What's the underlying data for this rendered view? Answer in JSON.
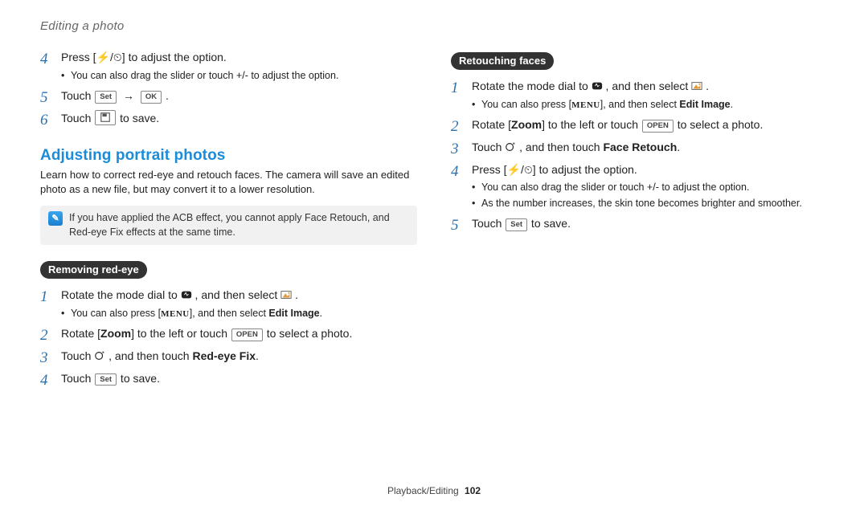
{
  "header": {
    "title": "Editing a photo"
  },
  "left": {
    "steps_a": [
      {
        "text": "Press [⚡/⏲] to adjust the option.",
        "sub": [
          "You can also drag the slider or touch +/- to adjust the option."
        ]
      },
      {
        "pre": "Touch ",
        "btn1": "Set",
        "arrow": "→",
        "btn2": "OK",
        "post": " ."
      },
      {
        "pre": "Touch ",
        "btn1": "💾",
        "post": " to save."
      }
    ],
    "heading": "Adjusting portrait photos",
    "intro": "Learn how to correct red-eye and retouch faces. The camera will save an edited photo as a new file, but may convert it to a lower resolution.",
    "note": "If you have applied the ACB effect, you cannot apply Face Retouch, and Red-eye Fix effects at the same time.",
    "pill": "Removing red-eye",
    "steps_b": [
      {
        "pre": "Rotate the mode dial to ",
        "icon": "magic",
        "mid": ", and then select ",
        "icon2": "picture",
        "post": ".",
        "sub_pre": "You can also press [",
        "sub_menu": "MENU",
        "sub_mid": "], and then select ",
        "sub_bold": "Edit Image",
        "sub_post": "."
      },
      {
        "pre": "Rotate [",
        "bold1": "Zoom",
        "mid": "] to the left or touch ",
        "btn": "OPEN",
        "post": " to select a photo."
      },
      {
        "pre": "Touch ",
        "icon": "retouch",
        "mid": ", and then touch ",
        "bold1": "Red-eye Fix",
        "post": "."
      },
      {
        "pre": "Touch ",
        "btn": "Set",
        "post": " to save."
      }
    ]
  },
  "right": {
    "pill": "Retouching faces",
    "steps": [
      {
        "pre": "Rotate the mode dial to ",
        "icon": "magic",
        "mid": ", and then select ",
        "icon2": "picture",
        "post": ".",
        "sub_pre": "You can also press [",
        "sub_menu": "MENU",
        "sub_mid": "], and then select ",
        "sub_bold": "Edit Image",
        "sub_post": "."
      },
      {
        "pre": "Rotate [",
        "bold1": "Zoom",
        "mid": "] to the left or touch ",
        "btn": "OPEN",
        "post": " to select a photo."
      },
      {
        "pre": "Touch ",
        "icon": "retouch",
        "mid": ", and then touch ",
        "bold1": "Face Retouch",
        "post": "."
      },
      {
        "text": "Press [⚡/⏲] to adjust the option.",
        "sub2": [
          "You can also drag the slider or touch +/- to adjust the option.",
          "As the number increases, the skin tone becomes brighter and smoother."
        ]
      },
      {
        "pre": "Touch ",
        "btn": "Set",
        "post": " to save."
      }
    ]
  },
  "footer": {
    "section": "Playback/Editing",
    "page": "102"
  }
}
